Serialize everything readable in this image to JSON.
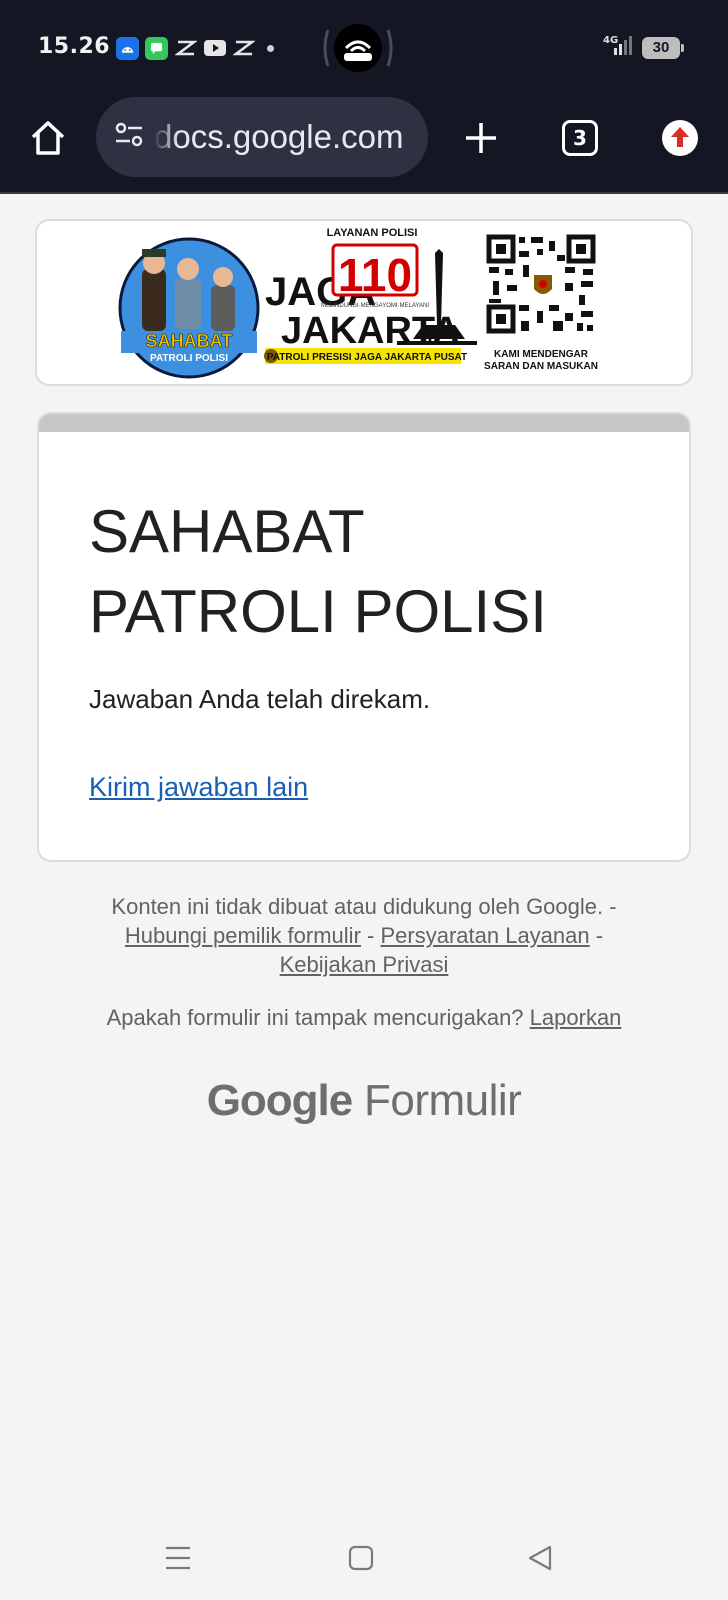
{
  "status_bar": {
    "time": "15.26",
    "network": "4G",
    "battery": "30"
  },
  "toolbar": {
    "url": "docs.google.com",
    "tab_count": "3"
  },
  "banner": {
    "badge_top": "SAHABAT",
    "badge_bottom": "PATROLI POLISI",
    "service_label": "LAYANAN POLISI",
    "jaga": "JAGA",
    "number": "110",
    "tagline": "MELINDUNGI·MENGAYOMI·MELAYANI",
    "jakarta": "JAKARTA",
    "ribbon": "PATROLI PRESISI JAGA JAKARTA PUSAT",
    "qr_caption_1": "KAMI MENDENGAR",
    "qr_caption_2": "SARAN DAN MASUKAN"
  },
  "form": {
    "title_line1": "SAHABAT",
    "title_line2": "PATROLI POLISI",
    "confirmation": "Jawaban Anda telah direkam.",
    "submit_another": "Kirim jawaban lain"
  },
  "footer": {
    "disclaimer": "Konten ini tidak dibuat atau didukung oleh Google. -",
    "contact_owner": "Hubungi pemilik formulir",
    "sep1": "-",
    "terms": "Persyaratan Layanan",
    "sep2": "-",
    "privacy": "Kebijakan Privasi",
    "suspicious": "Apakah formulir ini tampak mencurigakan?",
    "report": "Laporkan",
    "brand_google": "Google",
    "brand_forms": "Formulir"
  }
}
